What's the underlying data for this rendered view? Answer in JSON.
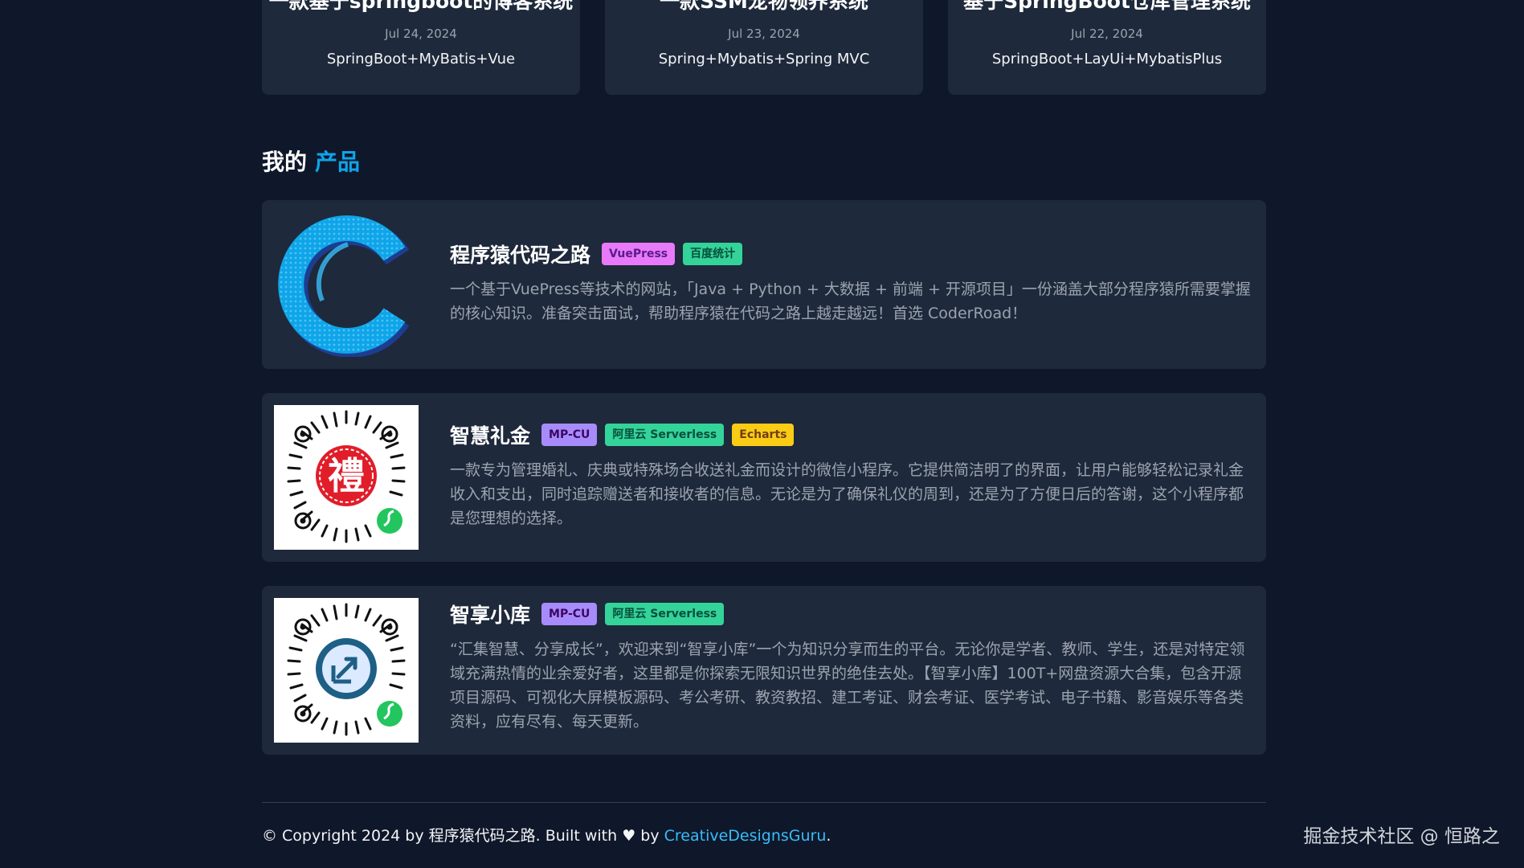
{
  "posts": [
    {
      "title": "一款基于springboot的博客系统",
      "date": "Jul 24, 2024",
      "desc": "SpringBoot+MyBatis+Vue"
    },
    {
      "title": "一款SSM宠物领养系统",
      "date": "Jul 23, 2024",
      "desc": "Spring+Mybatis+Spring MVC"
    },
    {
      "title": "基于SpringBoot仓库管理系统",
      "date": "Jul 22, 2024",
      "desc": "SpringBoot+LayUi+MybatisPlus"
    }
  ],
  "section": {
    "title_prefix": "我的",
    "title_highlight": "产品"
  },
  "products": [
    {
      "name": "程序猿代码之路",
      "tags": [
        {
          "label": "VuePress",
          "bg": "#e879f9",
          "fg": "#581c87"
        },
        {
          "label": "百度统计",
          "bg": "#34d399",
          "fg": "#064e3b"
        }
      ],
      "desc": "一个基于VuePress等技术的网站，「Java + Python + 大数据 + 前端 + 开源项目」一份涵盖大部分程序猿所需要掌握的核心知识。准备突击面试，帮助程序猿在代码之路上越走越远！首选 CoderRoad！",
      "image": "c-logo-icon"
    },
    {
      "name": "智慧礼金",
      "tags": [
        {
          "label": "MP-CU",
          "bg": "#a78bfa",
          "fg": "#3b0764"
        },
        {
          "label": "阿里云 Serverless",
          "bg": "#34d399",
          "fg": "#064e3b"
        },
        {
          "label": "Echarts",
          "bg": "#facc15",
          "fg": "#713f12"
        }
      ],
      "desc": "一款专为管理婚礼、庆典或特殊场合收送礼金而设计的微信小程序。它提供简洁明了的界面，让用户能够轻松记录礼金收入和支出，同时追踪赠送者和接收者的信息。无论是为了确保礼仪的周到，还是为了方便日后的答谢，这个小程序都是您理想的选择。",
      "image": "miniprogram-qr-icon",
      "center_char": "禮"
    },
    {
      "name": "智享小库",
      "tags": [
        {
          "label": "MP-CU",
          "bg": "#a78bfa",
          "fg": "#3b0764"
        },
        {
          "label": "阿里云 Serverless",
          "bg": "#34d399",
          "fg": "#064e3b"
        }
      ],
      "desc": "“汇集智慧、分享成长”，欢迎来到“智享小库”一个为知识分享而生的平台。无论你是学者、教师、学生，还是对特定领域充满热情的业余爱好者，这里都是你探索无限知识世界的绝佳去处。【智享小库】100T+网盘资源大合集，包含开源项目源码、可视化大屏模板源码、考公考研、教资教招、建工考证、财会考证、医学考试、电子书籍、影音娱乐等各类资料，应有尽有、每天更新。",
      "image": "miniprogram-qr-icon"
    }
  ],
  "footer": {
    "text_before": "© Copyright 2024 by 程序猿代码之路. Built with ♥ by ",
    "link": "CreativeDesignsGuru",
    "text_after": "."
  },
  "watermark": "掘金技术社区 @ 恒路之"
}
